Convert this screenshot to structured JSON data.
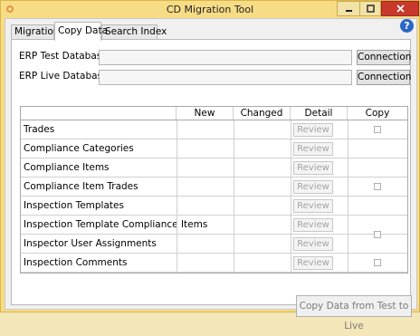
{
  "window": {
    "title": "CD Migration Tool"
  },
  "tabs": [
    {
      "label": "Migration"
    },
    {
      "label": "Copy Data"
    },
    {
      "label": "Search Index"
    }
  ],
  "help_label": "?",
  "databases": {
    "test": {
      "label": "ERP Test Database",
      "value": "",
      "button": "Connection"
    },
    "live": {
      "label": "ERP Live Database",
      "value": "",
      "button": "Connection"
    }
  },
  "grid": {
    "columns": [
      "",
      "New",
      "Changed",
      "Detail",
      "Copy"
    ],
    "review_label": "Review",
    "rows": [
      {
        "name": "Trades"
      },
      {
        "name": "Compliance Categories"
      },
      {
        "name": "Compliance Items"
      },
      {
        "name": "Compliance Item Trades"
      },
      {
        "name": "Inspection Templates"
      },
      {
        "name": "Inspection Template Compliance Items"
      },
      {
        "name": "Inspector User Assignments"
      },
      {
        "name": "Inspection Comments"
      }
    ]
  },
  "copy_button": "Copy Data from Test to Live",
  "colors": {
    "title_bar": "#f7dc86",
    "close_button": "#c8382c",
    "help_icon": "#2a66c6"
  }
}
